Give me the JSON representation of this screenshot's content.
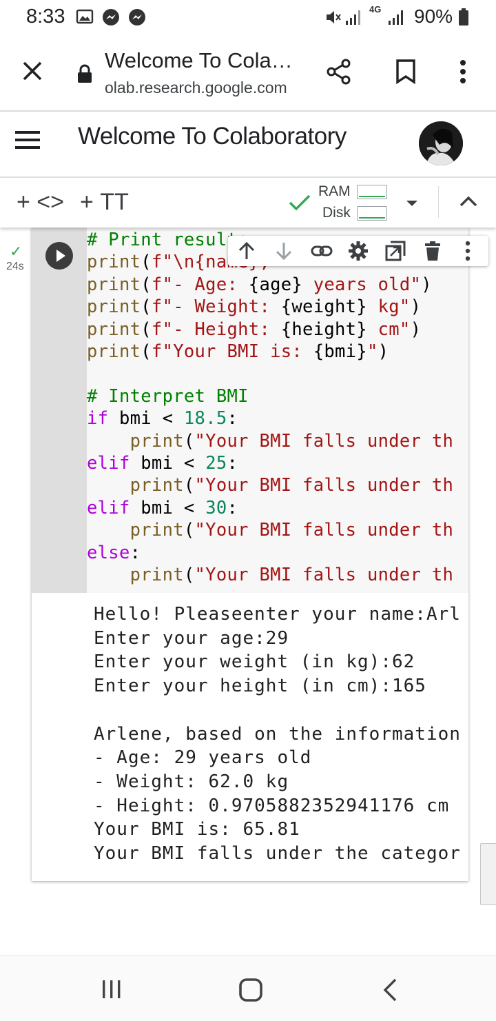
{
  "status_bar": {
    "time": "8:33",
    "battery": "90%",
    "network": "4G"
  },
  "browser": {
    "title": "Welcome To Cola…",
    "domain": "olab.research.google.com"
  },
  "colab": {
    "notebook_title": "Welcome To Colaboratory",
    "toolbar": {
      "add_code": "+ <>",
      "add_text": "+ ТТ",
      "ram_label": "RAM",
      "disk_label": "Disk"
    }
  },
  "cell": {
    "exec_time": "24s",
    "code_lines": [
      [
        {
          "t": "# Print results",
          "c": "com"
        }
      ],
      [
        {
          "t": "print",
          "c": "fn"
        },
        {
          "t": "(",
          "c": "def"
        },
        {
          "t": "f\"\\n{name}, ",
          "c": "str"
        }
      ],
      [
        {
          "t": "print",
          "c": "fn"
        },
        {
          "t": "(",
          "c": "def"
        },
        {
          "t": "f\"- Age: ",
          "c": "str"
        },
        {
          "t": "{age}",
          "c": "def"
        },
        {
          "t": " years old\"",
          "c": "str"
        },
        {
          "t": ")",
          "c": "def"
        }
      ],
      [
        {
          "t": "print",
          "c": "fn"
        },
        {
          "t": "(",
          "c": "def"
        },
        {
          "t": "f\"- Weight: ",
          "c": "str"
        },
        {
          "t": "{weight}",
          "c": "def"
        },
        {
          "t": " kg\"",
          "c": "str"
        },
        {
          "t": ")",
          "c": "def"
        }
      ],
      [
        {
          "t": "print",
          "c": "fn"
        },
        {
          "t": "(",
          "c": "def"
        },
        {
          "t": "f\"- Height: ",
          "c": "str"
        },
        {
          "t": "{height}",
          "c": "def"
        },
        {
          "t": " cm\"",
          "c": "str"
        },
        {
          "t": ")",
          "c": "def"
        }
      ],
      [
        {
          "t": "print",
          "c": "fn"
        },
        {
          "t": "(",
          "c": "def"
        },
        {
          "t": "f\"Your BMI is: ",
          "c": "str"
        },
        {
          "t": "{bmi}",
          "c": "def"
        },
        {
          "t": "\"",
          "c": "str"
        },
        {
          "t": ")",
          "c": "def"
        }
      ],
      [],
      [
        {
          "t": "# Interpret BMI",
          "c": "com"
        }
      ],
      [
        {
          "t": "if",
          "c": "kw"
        },
        {
          "t": " bmi < ",
          "c": "def"
        },
        {
          "t": "18.5",
          "c": "num"
        },
        {
          "t": ":",
          "c": "def"
        }
      ],
      [
        {
          "t": "    print",
          "c": "fn"
        },
        {
          "t": "(",
          "c": "def"
        },
        {
          "t": "\"Your BMI falls under th",
          "c": "str"
        }
      ],
      [
        {
          "t": "elif",
          "c": "kw"
        },
        {
          "t": " bmi < ",
          "c": "def"
        },
        {
          "t": "25",
          "c": "num"
        },
        {
          "t": ":",
          "c": "def"
        }
      ],
      [
        {
          "t": "    print",
          "c": "fn"
        },
        {
          "t": "(",
          "c": "def"
        },
        {
          "t": "\"Your BMI falls under th",
          "c": "str"
        }
      ],
      [
        {
          "t": "elif",
          "c": "kw"
        },
        {
          "t": " bmi < ",
          "c": "def"
        },
        {
          "t": "30",
          "c": "num"
        },
        {
          "t": ":",
          "c": "def"
        }
      ],
      [
        {
          "t": "    print",
          "c": "fn"
        },
        {
          "t": "(",
          "c": "def"
        },
        {
          "t": "\"Your BMI falls under th",
          "c": "str"
        }
      ],
      [
        {
          "t": "else",
          "c": "kw"
        },
        {
          "t": ":",
          "c": "def"
        }
      ],
      [
        {
          "t": "    print",
          "c": "fn"
        },
        {
          "t": "(",
          "c": "def"
        },
        {
          "t": "\"Your BMI falls under th",
          "c": "str"
        }
      ]
    ],
    "output_lines": [
      "Hello! Pleaseenter your name:Arl",
      "Enter your age:29",
      "Enter your weight (in kg):62",
      "Enter your height (in cm):165",
      "",
      "Arlene, based on the information",
      "- Age: 29 years old",
      "- Weight: 62.0 kg",
      "- Height: 0.9705882352941176 cm",
      "Your BMI is: 65.81",
      "Your BMI falls under the categor"
    ]
  },
  "colors": {
    "accent_green": "#34a853",
    "comment": "#008000",
    "string": "#a31515",
    "keyword": "#af00db",
    "number": "#098658",
    "function": "#795e26"
  },
  "icons": {
    "status_bar": [
      "image-icon",
      "messenger-icon",
      "messenger-icon",
      "mute-icon",
      "signal-icon",
      "signal-icon",
      "battery-icon"
    ],
    "browser": [
      "close-icon",
      "lock-icon",
      "share-icon",
      "bookmark-icon",
      "more-vert-icon"
    ],
    "cell_toolbar": [
      "arrow-up-icon",
      "arrow-down-icon",
      "link-icon",
      "settings-icon",
      "mirror-cell-icon",
      "delete-icon",
      "more-vert-icon"
    ],
    "nav": [
      "recent-apps-icon",
      "home-icon",
      "back-icon"
    ]
  }
}
